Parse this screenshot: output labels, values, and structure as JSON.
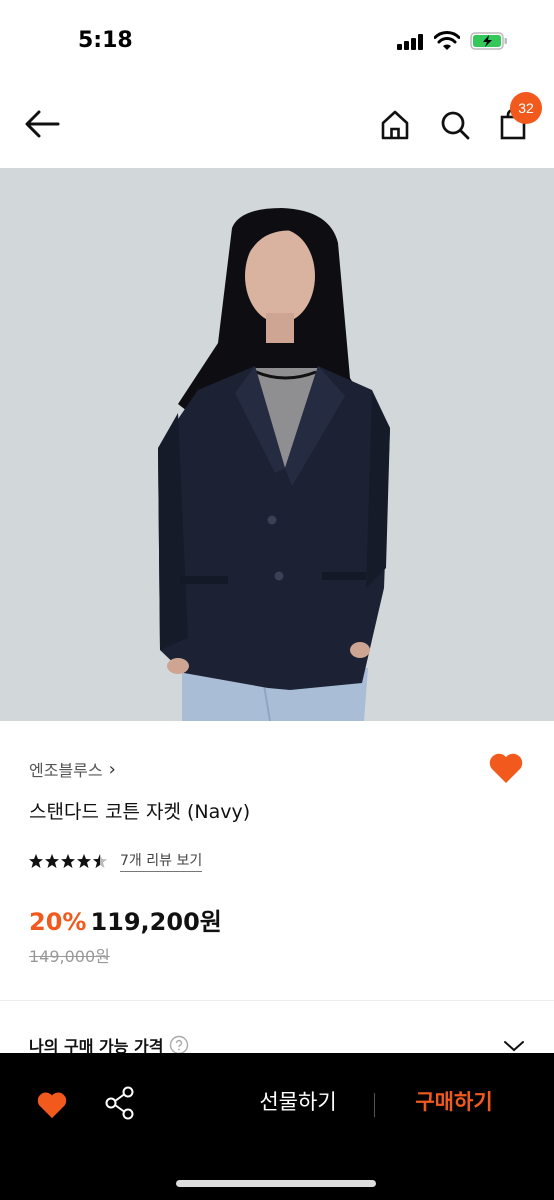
{
  "status_bar": {
    "time": "5:18"
  },
  "header": {
    "cart_count": "32"
  },
  "product": {
    "brand": "엔조블루스",
    "brand_chevron": "›",
    "title": "스탠다드 코튼 자켓 (Navy)",
    "rating": 4.5,
    "review_link": "7개 리뷰 보기",
    "discount": "20%",
    "sale_price": "119,200원",
    "original_price": "149,000원",
    "liked": true
  },
  "my_price": {
    "label": "나의 구매 가능 가격"
  },
  "bottom_bar": {
    "gift_label": "선물하기",
    "buy_label": "구매하기"
  },
  "colors": {
    "accent": "#f25a1d",
    "image_bg": "#d2d7da",
    "bottom_bar": "#000000"
  },
  "icons": [
    "back-arrow-icon",
    "home-icon",
    "search-icon",
    "shopping-bag-icon",
    "heart-icon",
    "star-icon",
    "help-icon",
    "chevron-down-icon",
    "share-icon"
  ]
}
